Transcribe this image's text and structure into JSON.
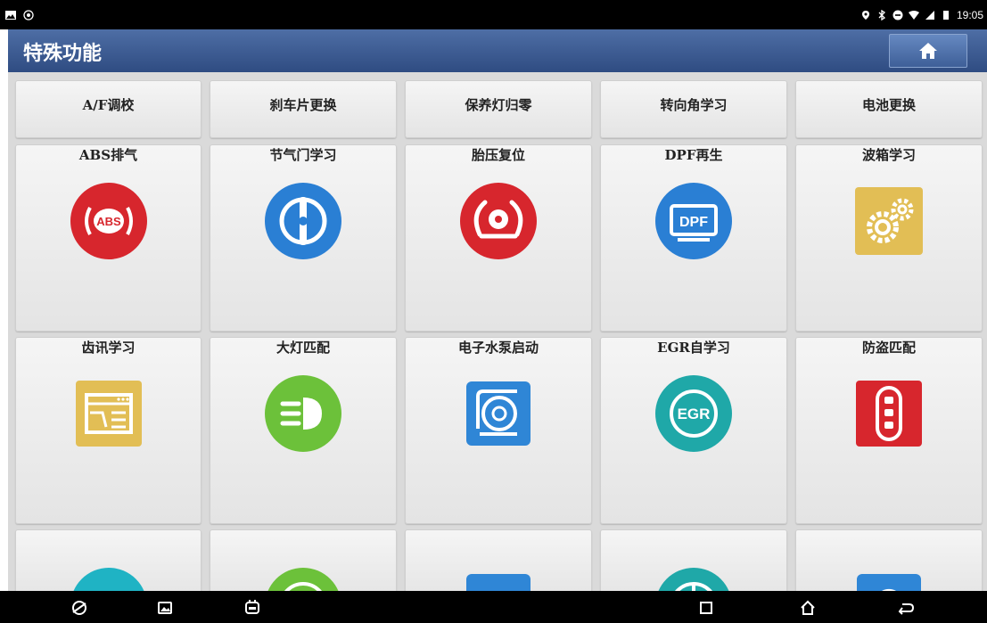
{
  "status_bar": {
    "time": "19:05"
  },
  "header": {
    "title": "特殊功能"
  },
  "quick_row": [
    "A/F调校",
    "刹车片更换",
    "保养灯归零",
    "转向角学习",
    "电池更换"
  ],
  "row2": [
    {
      "label": "ABS排气",
      "icon": "abs-icon",
      "color": "#d7262d"
    },
    {
      "label": "节气门学习",
      "icon": "throttle-icon",
      "color": "#2a7fd4"
    },
    {
      "label": "胎压复位",
      "icon": "tire-pressure-icon",
      "color": "#d7262d"
    },
    {
      "label": "DPF再生",
      "icon": "dpf-icon",
      "color": "#2a7fd4"
    },
    {
      "label": "波箱学习",
      "icon": "gears-icon",
      "color": "#e2be55"
    }
  ],
  "row3": [
    {
      "label": "齿讯学习",
      "icon": "window-chart-icon",
      "color": "#e2be55"
    },
    {
      "label": "大灯匹配",
      "icon": "headlight-icon",
      "color": "#6cc13a"
    },
    {
      "label": "电子水泵启动",
      "icon": "water-pump-icon",
      "color": "#2f86d6"
    },
    {
      "label": "EGR自学习",
      "icon": "egr-icon",
      "color": "#1fa8a8"
    },
    {
      "label": "防盗匹配",
      "icon": "car-key-icon",
      "color": "#d7262d"
    }
  ],
  "egr_text": "EGR",
  "abs_text": "ABS",
  "dpf_text": "DPF"
}
